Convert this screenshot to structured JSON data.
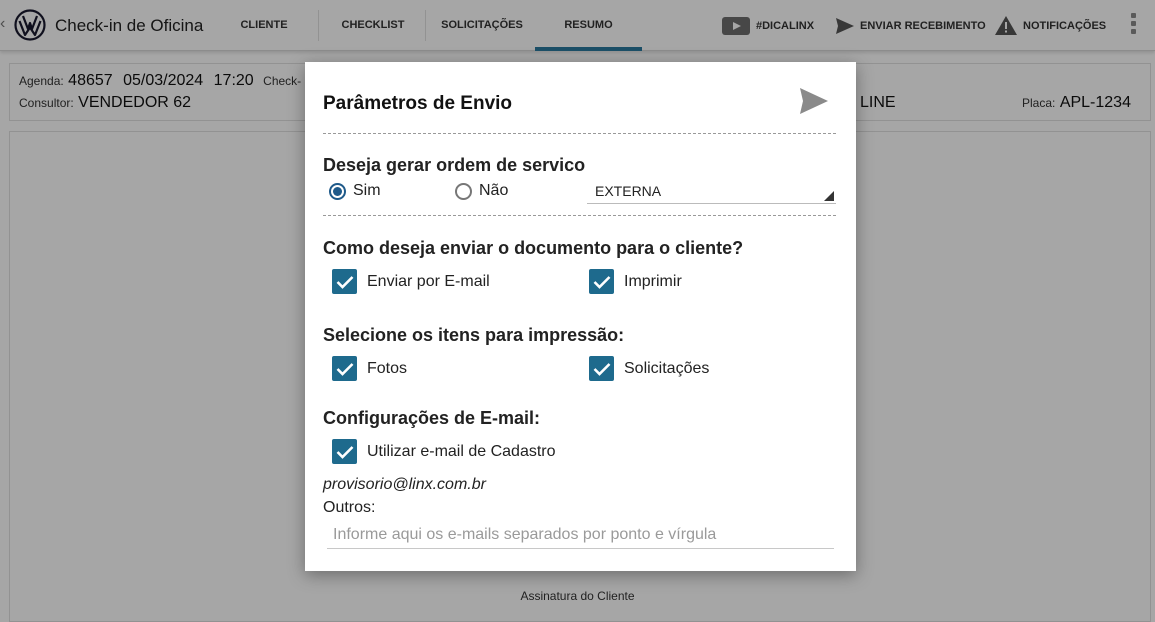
{
  "app": {
    "title": "Check-in de Oficina",
    "tabs": [
      {
        "label": "CLIENTE",
        "active": false
      },
      {
        "label": "CHECKLIST",
        "active": false
      },
      {
        "label": "SOLICITAÇÕES",
        "active": false
      },
      {
        "label": "RESUMO",
        "active": true
      }
    ],
    "actions": {
      "dicas": "#DICALINX",
      "enviar": "ENVIAR RECEBIMENTO",
      "notificacoes": "NOTIFICAÇÕES"
    },
    "accent_color": "#2c7a9e"
  },
  "info": {
    "agenda_label": "Agenda:",
    "agenda_number": "48657",
    "agenda_date": "05/03/2024",
    "agenda_time": "17:20",
    "checkin_label": "Check-",
    "consultor_label": "Consultor:",
    "consultor_value": "VENDEDOR 62",
    "model_fragment": "LINE",
    "placa_label": "Placa:",
    "placa_value": "APL-1234"
  },
  "main": {
    "signature_label": "Assinatura do Cliente"
  },
  "dialog": {
    "title": "Parâmetros de Envio",
    "ordem": {
      "title": "Deseja gerar ordem de servico",
      "option_sim": "Sim",
      "option_nao": "Não",
      "selected": "Sim",
      "tipo_value": "EXTERNA"
    },
    "envio": {
      "title": "Como deseja enviar o documento para o cliente?",
      "email_label": "Enviar por E-mail",
      "email_checked": true,
      "imprimir_label": "Imprimir",
      "imprimir_checked": true
    },
    "impressao": {
      "title": "Selecione os itens para impressão:",
      "fotos_label": "Fotos",
      "fotos_checked": true,
      "solicitacoes_label": "Solicitações",
      "solicitacoes_checked": true
    },
    "email_config": {
      "title": "Configurações de E-mail:",
      "cadastro_label": "Utilizar e-mail de Cadastro",
      "cadastro_checked": true,
      "email_value": "provisorio@linx.com.br",
      "outros_label": "Outros:",
      "outros_placeholder": "Informe aqui os e-mails separados por ponto e vírgula",
      "outros_value": ""
    },
    "checkbox_color": "#1e6a8d"
  }
}
